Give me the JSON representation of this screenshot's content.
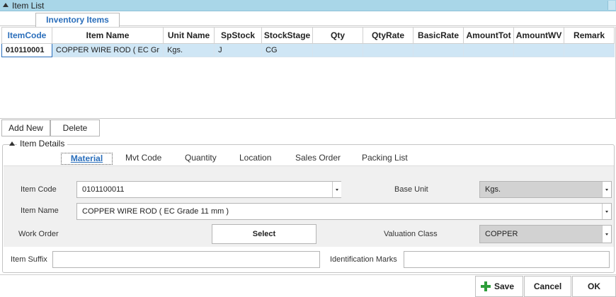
{
  "window": {
    "title": "Item List"
  },
  "tabs": {
    "active": "Inventory Items"
  },
  "grid": {
    "columns": [
      "ItemCode",
      "Item Name",
      "Unit Name",
      "SpStock",
      "StockStage",
      "Qty",
      "QtyRate",
      "BasicRate",
      "AmountTot",
      "AmountWV",
      "Remark"
    ],
    "rows": [
      [
        "010110001",
        "COPPER WIRE ROD ( EC Gr",
        "Kgs.",
        "J",
        "CG",
        "",
        "",
        "",
        "",
        "",
        ""
      ]
    ]
  },
  "actions": {
    "add_new": "Add New",
    "delete": "Delete"
  },
  "details": {
    "legend": "Item Details",
    "tabs": [
      "Material",
      "Mvt Code",
      "Quantity",
      "Location",
      "Sales Order",
      "Packing List"
    ],
    "labels": {
      "item_code": "Item Code",
      "item_name": "Item Name",
      "work_order": "Work Order",
      "base_unit": "Base Unit",
      "valuation_class": "Valuation Class",
      "item_suffix": "Item Suffix",
      "identification_marks": "Identification Marks"
    },
    "values": {
      "item_code": "0101100011",
      "item_name": "COPPER WIRE ROD ( EC Grade 11 mm )",
      "base_unit": "Kgs.",
      "valuation_class": "COPPER",
      "item_suffix": "",
      "identification_marks": ""
    },
    "select_button": "Select"
  },
  "footer": {
    "save": "Save",
    "cancel": "Cancel",
    "ok": "OK"
  },
  "colors": {
    "accent": "#2a6ebb",
    "header_bar": "#a9d6e8",
    "row_highlight": "#cfe6f5",
    "save_icon": "#2e9e3a"
  }
}
